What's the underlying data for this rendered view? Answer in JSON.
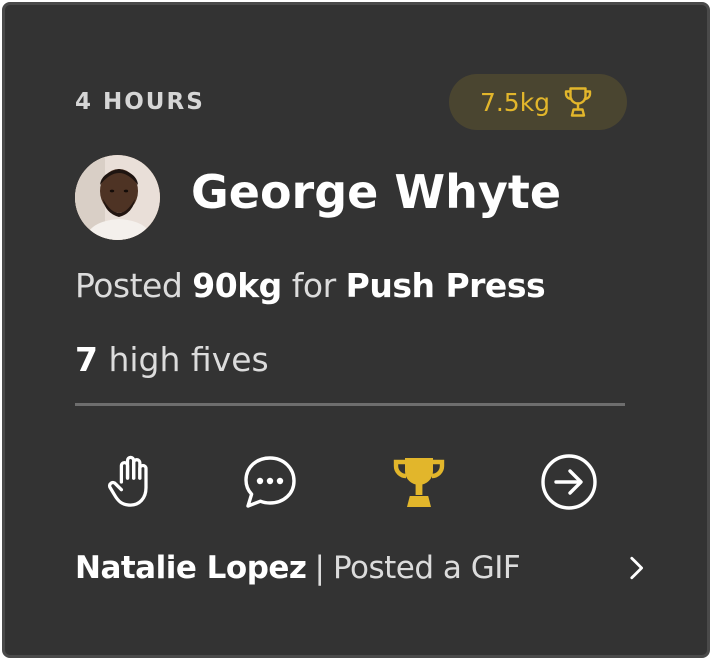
{
  "post": {
    "time_ago": "4 HOURS",
    "award_value": "7.5kg",
    "author_name": "George Whyte",
    "posted_prefix": "Posted",
    "weight": "90kg",
    "for_word": "for",
    "exercise": "Push Press",
    "high_five_count": "7",
    "high_five_suffix": "high fives"
  },
  "actions": [
    {
      "name": "high-five",
      "icon": "hand-icon"
    },
    {
      "name": "comment",
      "icon": "chat-bubble-icon"
    },
    {
      "name": "award",
      "icon": "trophy-icon"
    },
    {
      "name": "share",
      "icon": "arrow-circle-icon"
    }
  ],
  "activity": {
    "user_name": "Natalie Lopez",
    "separator": "|",
    "text": "Posted a GIF"
  },
  "colors": {
    "card_background": "#333333",
    "accent_gold": "#e2b62b",
    "badge_background": "#4a4530",
    "divider": "#6e6e6e"
  }
}
